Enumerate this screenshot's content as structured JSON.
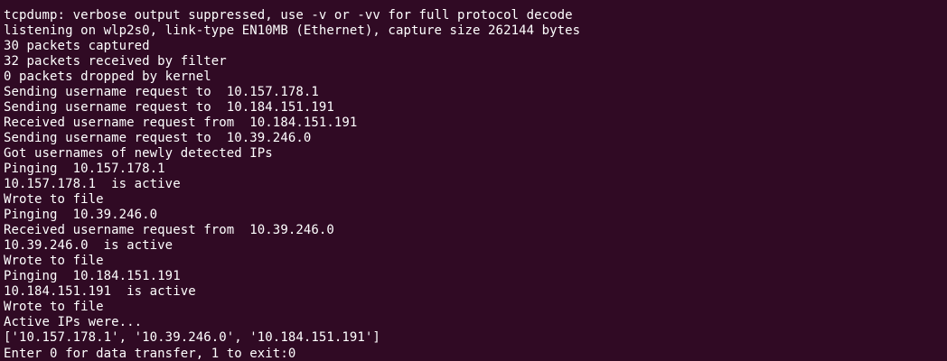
{
  "terminal": {
    "lines": [
      "tcpdump: verbose output suppressed, use -v or -vv for full protocol decode",
      "listening on wlp2s0, link-type EN10MB (Ethernet), capture size 262144 bytes",
      "30 packets captured",
      "32 packets received by filter",
      "0 packets dropped by kernel",
      "Sending username request to  10.157.178.1",
      "Sending username request to  10.184.151.191",
      "Received username request from  10.184.151.191",
      "Sending username request to  10.39.246.0",
      "Got usernames of newly detected IPs",
      "Pinging  10.157.178.1",
      "10.157.178.1  is active",
      "Wrote to file",
      "Pinging  10.39.246.0",
      "Received username request from  10.39.246.0",
      "10.39.246.0  is active",
      "Wrote to file",
      "Pinging  10.184.151.191",
      "10.184.151.191  is active",
      "Wrote to file",
      "Active IPs were...",
      "['10.157.178.1', '10.39.246.0', '10.184.151.191']",
      "Enter 0 for data transfer, 1 to exit:0"
    ]
  },
  "colors": {
    "background": "#300a24",
    "text": "#ffffff"
  }
}
